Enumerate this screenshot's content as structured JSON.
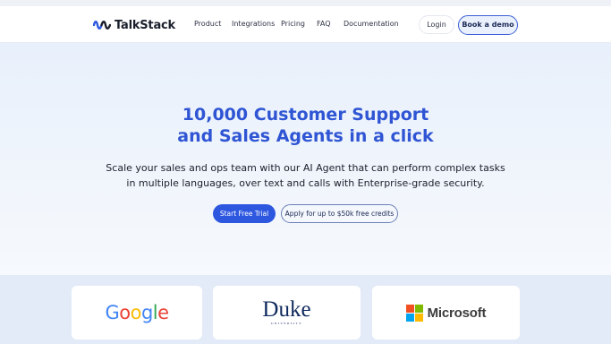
{
  "brand": {
    "name": "TalkStack",
    "logo_icon": "wave-logo-icon",
    "accent_color": "#2f55d4"
  },
  "nav": {
    "links": [
      "Product",
      "Integrations",
      "Pricing",
      "FAQ",
      "Documentation"
    ],
    "login_label": "Login",
    "demo_label": "Book a demo"
  },
  "hero": {
    "headline_lines": [
      "10,000 Customer Support",
      "and Sales Agents in a click"
    ],
    "subtext_lines": [
      "Scale your sales and ops team with our AI Agent that can perform complex tasks",
      "in multiple languages, over text and calls with Enterprise-grade security."
    ],
    "primary_cta": "Start Free Trial",
    "secondary_cta": "Apply for up to $50k free credits"
  },
  "customers": {
    "google": {
      "text": "Google",
      "colors": [
        "#4285f4",
        "#ea4335",
        "#fbbc05",
        "#4285f4",
        "#34a853",
        "#ea4335"
      ]
    },
    "duke": {
      "text": "Duke",
      "subtext": "UNIVERSITY",
      "color": "#10295e"
    },
    "microsoft": {
      "text": "Microsoft",
      "square_colors": [
        "#f25022",
        "#7fba00",
        "#00a4ef",
        "#ffb900"
      ]
    }
  }
}
